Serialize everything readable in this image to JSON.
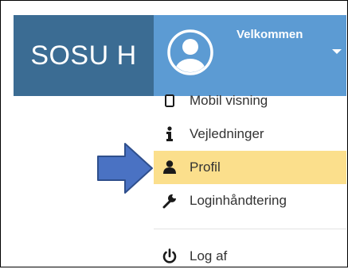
{
  "header": {
    "brand": "SOSU H",
    "welcome": "Velkommen"
  },
  "colors": {
    "brand_bg": "#3b6c93",
    "user_bar_bg": "#5c9bd3",
    "highlight": "#fbdf8c",
    "arrow": "#4a72c3"
  },
  "menu": {
    "items": [
      {
        "label": "Mobil visning",
        "icon": "mobile-icon"
      },
      {
        "label": "Vejledninger",
        "icon": "info-icon"
      },
      {
        "label": "Profil",
        "icon": "user-icon",
        "active": true
      },
      {
        "label": "Loginhåndtering",
        "icon": "wrench-icon"
      },
      {
        "label": "Log af",
        "icon": "power-icon"
      }
    ]
  },
  "annotation": {
    "icon": "arrow-right-icon"
  }
}
